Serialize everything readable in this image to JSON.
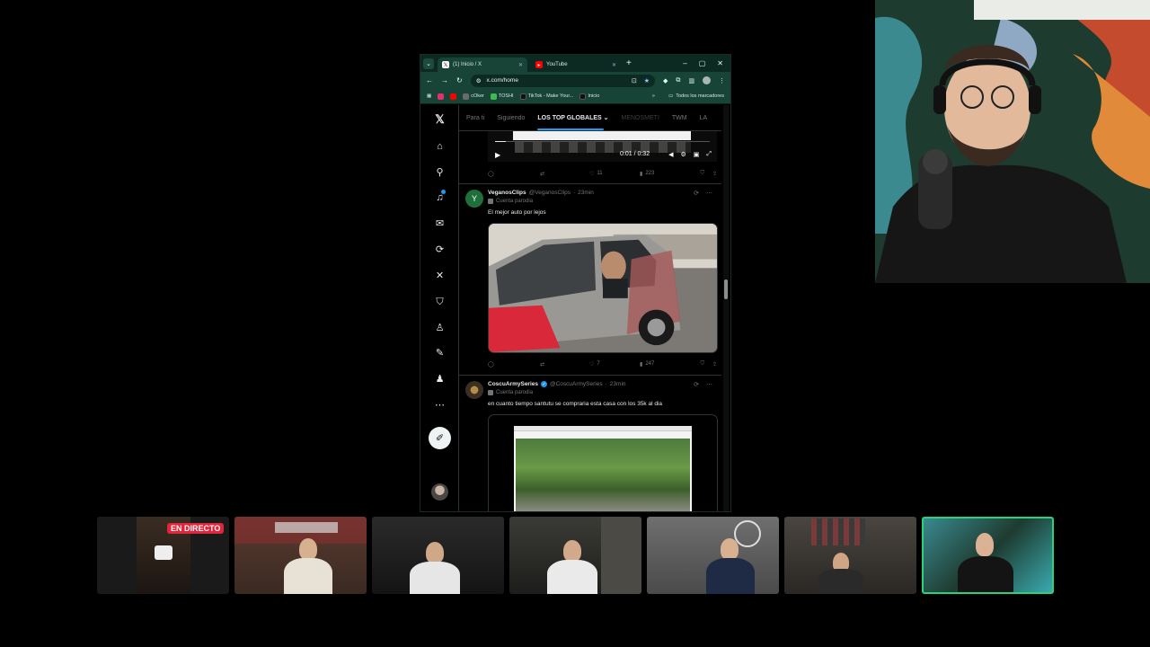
{
  "browser": {
    "tabs": [
      {
        "label": "(1) Inicio / X",
        "active": true,
        "favicon": "x-icon"
      },
      {
        "label": "YouTube",
        "active": false,
        "favicon": "youtube-icon"
      }
    ],
    "url": "x.com/home",
    "bookmarks": [
      {
        "label": "",
        "icon": "instagram-icon",
        "color": "#e1306c"
      },
      {
        "label": "",
        "icon": "youtube-icon",
        "color": "#ff0000"
      },
      {
        "label": "cOker",
        "icon": "bookmark-favicon",
        "color": "#6a6a6a"
      },
      {
        "label": "TOSHI",
        "icon": "bookmark-favicon",
        "color": "#3fb950"
      },
      {
        "label": "TikTok - Make Your...",
        "icon": "tiktok-icon",
        "color": "#111111"
      },
      {
        "label": "Inicio",
        "icon": "x-icon",
        "color": "#111111"
      }
    ],
    "bookmarks_more": "»",
    "all_bookmarks": "Todos los marcadores"
  },
  "x": {
    "feed_tabs": [
      "Para ti",
      "Siguiendo",
      "LOS TOP GLOBALES",
      "MENOSMETI",
      "TWM",
      "LA"
    ],
    "active_tab": "LOS TOP GLOBALES",
    "video": {
      "time": "0:01 / 0:32",
      "progress": 0.05
    },
    "first_actions": {
      "reply": "",
      "repost": "",
      "likes": "11",
      "views": "223"
    },
    "posts": [
      {
        "name": "VeganosClips",
        "handle": "@VeganosClips",
        "time": "23min",
        "badge": "Cuenta parodia",
        "text": "El mejor auto por lejos",
        "likes": "7",
        "views": "247",
        "avatar_color": "#1f6f3a"
      },
      {
        "name": "CoscuArmySeries",
        "handle": "@CoscuArmySeries",
        "time": "23min",
        "badge": "Cuenta parodia",
        "text": "en cuanto tiempo santutu se compraria esta casa con los 35k al dia",
        "avatar_color": "#6b5a3e"
      }
    ]
  },
  "stream": {
    "live_label": "EN DIRECTO",
    "thumbnails": 7,
    "selected_index": 6
  },
  "colors": {
    "accent": "#1d9bf0",
    "live": "#e3243b",
    "selected_border": "#2bd27c",
    "browser_frame": "#184438"
  }
}
